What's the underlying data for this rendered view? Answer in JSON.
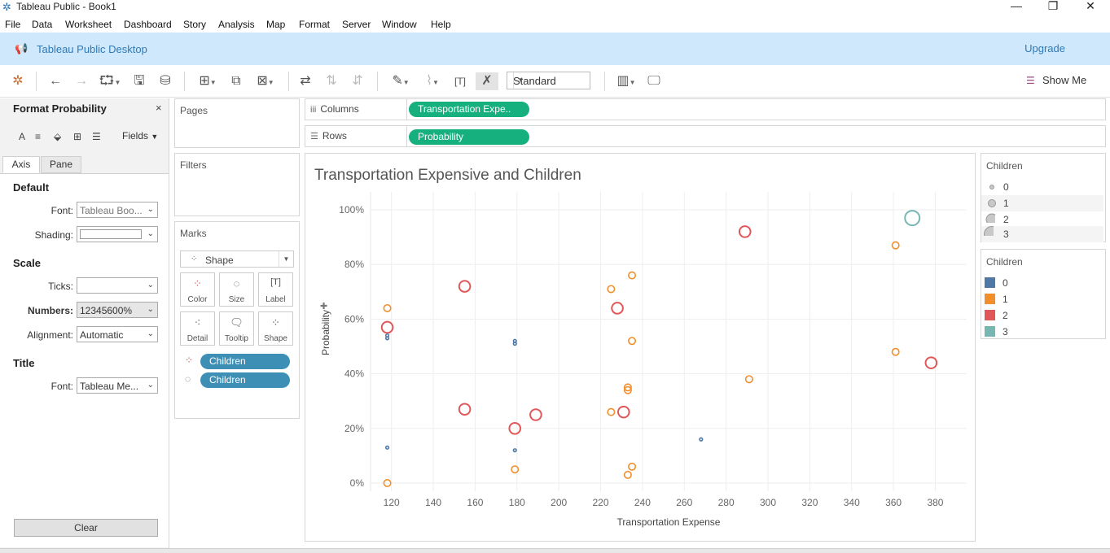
{
  "window": {
    "title": "Tableau Public - Book1"
  },
  "menu": [
    "File",
    "Data",
    "Worksheet",
    "Dashboard",
    "Story",
    "Analysis",
    "Map",
    "Format",
    "Server",
    "Window",
    "Help"
  ],
  "banner": {
    "text": "Tableau Public Desktop",
    "upgrade": "Upgrade"
  },
  "toolbar": {
    "fit_select": "Standard",
    "show_me": "Show Me"
  },
  "format_pane": {
    "title": "Format Probability",
    "fields_label": "Fields",
    "tabs": [
      "Axis",
      "Pane"
    ],
    "sections": {
      "default": "Default",
      "scale": "Scale",
      "title": "Title"
    },
    "labels": {
      "font": "Font:",
      "shading": "Shading:",
      "ticks": "Ticks:",
      "numbers": "Numbers:",
      "alignment": "Alignment:",
      "title_font": "Font:"
    },
    "values": {
      "font": "Tableau Boo...",
      "shading": "",
      "ticks": "",
      "numbers": "12345600%",
      "alignment": "Automatic",
      "title_font": "Tableau Me..."
    },
    "clear": "Clear"
  },
  "cards": {
    "pages": "Pages",
    "filters": "Filters",
    "marks": "Marks"
  },
  "marks": {
    "type": "Shape",
    "buttons": [
      "Color",
      "Size",
      "Label",
      "Detail",
      "Tooltip",
      "Shape"
    ],
    "pills": [
      "Children",
      "Children"
    ]
  },
  "shelves": {
    "columns_label": "Columns",
    "rows_label": "Rows",
    "columns_pill": "Transportation Expe..",
    "rows_pill": "Probability"
  },
  "legend_size": {
    "title": "Children",
    "items": [
      "0",
      "1",
      "2",
      "3"
    ]
  },
  "legend_color": {
    "title": "Children",
    "items": [
      {
        "label": "0",
        "color": "#4e79a7"
      },
      {
        "label": "1",
        "color": "#f28e2b"
      },
      {
        "label": "2",
        "color": "#e15759"
      },
      {
        "label": "3",
        "color": "#76b7b2"
      }
    ]
  },
  "chart_data": {
    "type": "scatter",
    "title": "Transportation Expensive and Children",
    "xlabel": "Transportation Expense",
    "ylabel": "Probability",
    "xlim": [
      110,
      395
    ],
    "ylim": [
      0,
      100
    ],
    "x_ticks": [
      120,
      140,
      160,
      180,
      200,
      220,
      240,
      260,
      280,
      300,
      320,
      340,
      360,
      380
    ],
    "y_ticks": [
      0,
      20,
      40,
      60,
      80,
      100
    ],
    "y_tick_labels": [
      "0%",
      "20%",
      "40%",
      "60%",
      "80%",
      "100%"
    ],
    "grid": true,
    "series": [
      {
        "name": "0",
        "color": "#4e79a7",
        "points": [
          [
            118,
            53
          ],
          [
            118,
            54
          ],
          [
            118,
            13
          ],
          [
            179,
            51
          ],
          [
            179,
            52
          ],
          [
            179,
            12
          ],
          [
            268,
            16
          ]
        ]
      },
      {
        "name": "1",
        "color": "#f28e2b",
        "points": [
          [
            118,
            64
          ],
          [
            118,
            0
          ],
          [
            179,
            5
          ],
          [
            225,
            71
          ],
          [
            235,
            76
          ],
          [
            235,
            52
          ],
          [
            233,
            35
          ],
          [
            233,
            34
          ],
          [
            225,
            26
          ],
          [
            235,
            6
          ],
          [
            233,
            3
          ],
          [
            291,
            38
          ],
          [
            361,
            87
          ],
          [
            361,
            48
          ]
        ]
      },
      {
        "name": "2",
        "color": "#e15759",
        "points": [
          [
            118,
            57
          ],
          [
            155,
            72
          ],
          [
            155,
            27
          ],
          [
            179,
            20
          ],
          [
            189,
            25
          ],
          [
            228,
            64
          ],
          [
            231,
            26
          ],
          [
            289,
            92
          ],
          [
            378,
            44
          ]
        ]
      },
      {
        "name": "3",
        "color": "#76b7b2",
        "points": [
          [
            369,
            97
          ]
        ]
      }
    ]
  }
}
